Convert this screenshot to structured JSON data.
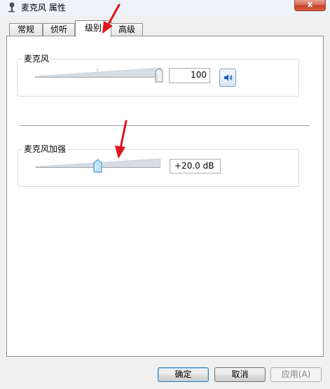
{
  "window": {
    "title": "麦克风 属性",
    "close_label": "x"
  },
  "tabs": [
    {
      "label": "常规",
      "active": false
    },
    {
      "label": "侦听",
      "active": false
    },
    {
      "label": "级别",
      "active": true
    },
    {
      "label": "高级",
      "active": false
    }
  ],
  "microphone": {
    "label": "麦克风",
    "value": "100",
    "level_fraction": 1.0,
    "mute_icon": "speaker-icon"
  },
  "boost": {
    "label": "麦克风加强",
    "value": "+20.0 dB",
    "level_fraction": 0.5
  },
  "buttons": {
    "ok": "确定",
    "cancel": "取消",
    "apply": "应用(A)"
  },
  "annotation_color": "#e0141b"
}
